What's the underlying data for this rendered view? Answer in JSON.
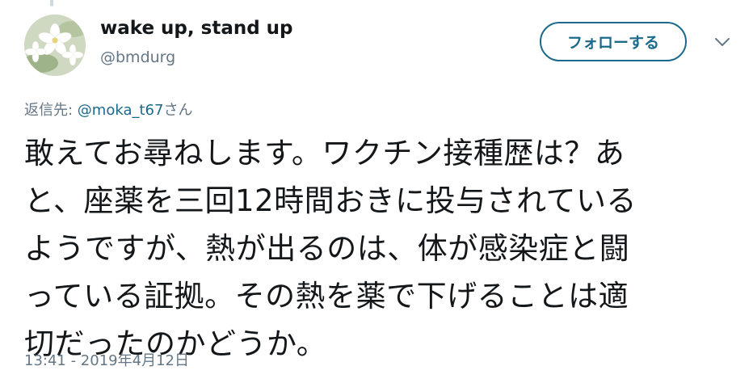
{
  "author": {
    "display_name": "wake up, stand up",
    "handle": "@bmdurg"
  },
  "follow_button": {
    "label": "フォローする"
  },
  "more_menu": {
    "icon": "chevron-down-icon"
  },
  "reply_context": {
    "prefix": "返信先: ",
    "mention": "@moka_t67",
    "suffix": "さん"
  },
  "tweet": {
    "text_lines": [
      "敢えてお尋ねします。ワクチン接種歴は？あ",
      "と、座薬を三回12時間おきに投与されている",
      "ようですが、熱が出るのは、体が感染症と闘",
      "っている証拠。その熱を薬で下げることは適",
      "切だったのかどうか。"
    ],
    "timestamp": "13:41 - 2019年4月12日"
  },
  "colors": {
    "accent": "#1b6a8c",
    "secondary_text": "#657786",
    "primary_text": "#14171a"
  }
}
